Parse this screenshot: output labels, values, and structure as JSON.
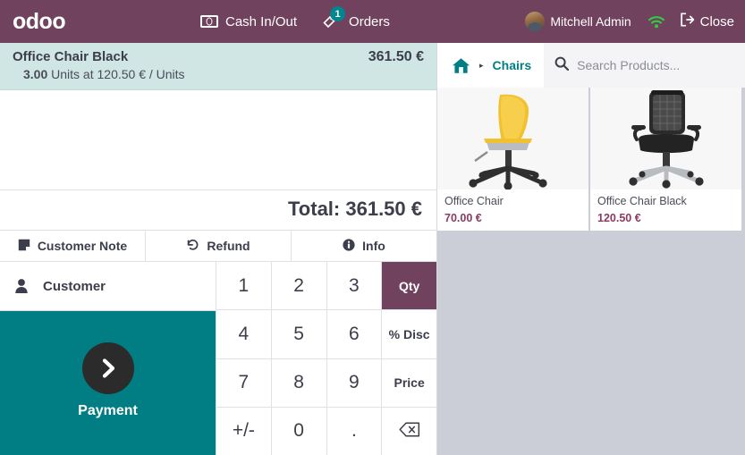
{
  "topbar": {
    "brand": "odoo",
    "cash_in_out": "Cash In/Out",
    "cash_icon": "cash-banknote-icon",
    "orders": "Orders",
    "orders_icon": "orders-tag-icon",
    "orders_badge": "1",
    "user_name": "Mitchell Admin",
    "avatar_icon": "user-avatar",
    "wifi_icon": "wifi-icon",
    "close": "Close",
    "close_icon": "logout-icon",
    "bg_color": "#71425E",
    "badge_color": "#00868F"
  },
  "order": {
    "lines": [
      {
        "name": "Office Chair Black",
        "price": "361.50 €",
        "qty": "3.00",
        "detail_unit": "Units at",
        "detail_price": "120.50 € / Units",
        "detail_full": "Units at 120.50 € / Units",
        "selected_bg": "#CFE6E4"
      }
    ],
    "total_label": "Total: 361.50 €"
  },
  "pads": [
    {
      "label": "Customer Note",
      "icon": "note-icon"
    },
    {
      "label": "Refund",
      "icon": "refund-rotate-icon"
    },
    {
      "label": "Info",
      "icon": "info-circle-icon"
    }
  ],
  "customer": {
    "label": "Customer",
    "icon": "person-icon"
  },
  "payment": {
    "label": "Payment",
    "icon": "chevron-right-icon",
    "bg_color": "#017E84"
  },
  "numpad": {
    "keys": [
      {
        "label": "1",
        "type": "digit"
      },
      {
        "label": "2",
        "type": "digit"
      },
      {
        "label": "3",
        "type": "digit"
      },
      {
        "label": "Qty",
        "type": "mode",
        "active": true
      },
      {
        "label": "4",
        "type": "digit"
      },
      {
        "label": "5",
        "type": "digit"
      },
      {
        "label": "6",
        "type": "digit"
      },
      {
        "label": "% Disc",
        "type": "mode",
        "active": false
      },
      {
        "label": "7",
        "type": "digit"
      },
      {
        "label": "8",
        "type": "digit"
      },
      {
        "label": "9",
        "type": "digit"
      },
      {
        "label": "Price",
        "type": "mode",
        "active": false
      },
      {
        "label": "+/-",
        "type": "digit"
      },
      {
        "label": "0",
        "type": "digit"
      },
      {
        "label": ".",
        "type": "digit"
      },
      {
        "label": "",
        "type": "backspace",
        "icon": "backspace-icon"
      }
    ],
    "active_color": "#71425E"
  },
  "search": {
    "home_icon": "home-icon",
    "separator": "▸",
    "category": "Chairs",
    "placeholder": "Search Products...",
    "search_icon": "search-icon"
  },
  "products": [
    {
      "name": "Office Chair",
      "price": "70.00 €",
      "image": "yellow-office-chair"
    },
    {
      "name": "Office Chair Black",
      "price": "120.50 €",
      "image": "black-office-chair"
    }
  ]
}
